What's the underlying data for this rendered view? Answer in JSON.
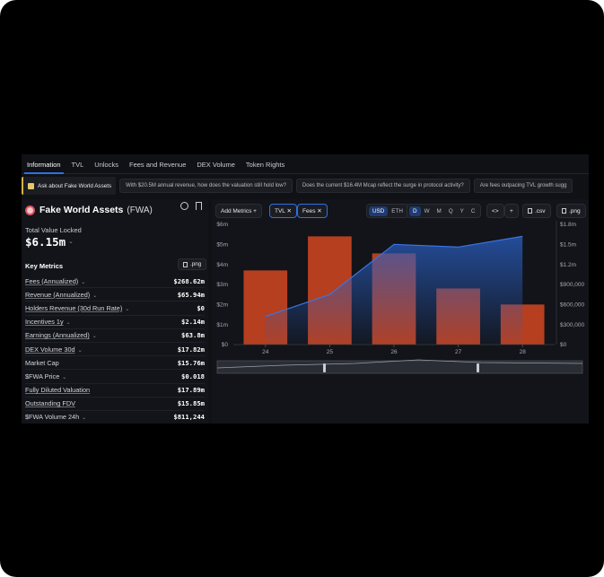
{
  "tabs": [
    "Information",
    "TVL",
    "Unlocks",
    "Fees and Revenue",
    "DEX Volume",
    "Token Rights"
  ],
  "ask": {
    "label": "Ask about Fake World Assets",
    "suggestions": [
      "With $20.5M annual revenue, how does the valuation still hold low?",
      "Does the current $16.4M Mcap reflect the surge in protocol activity?",
      "Are fees outpacing TVL growth sugg"
    ]
  },
  "protocol": {
    "name": "Fake World Assets",
    "symbol": "(FWA)",
    "tvl_label": "Total Value Locked",
    "tvl_value": "$6.15m"
  },
  "key_metrics": {
    "title": "Key Metrics",
    "png_label": ".png",
    "rows": [
      {
        "label": "Fees (Annualized)",
        "value": "$268.62m",
        "underline": true,
        "caret": true
      },
      {
        "label": "Revenue (Annualized)",
        "value": "$65.94m",
        "underline": true,
        "caret": true
      },
      {
        "label": "Holders Revenue (30d Run Rate)",
        "value": "$0",
        "underline": true,
        "caret": true
      },
      {
        "label": "Incentives 1y",
        "value": "$2.14m",
        "underline": true,
        "caret": true
      },
      {
        "label": "Earnings (Annualized)",
        "value": "$63.8m",
        "underline": true,
        "caret": true
      },
      {
        "label": "DEX Volume 30d",
        "value": "$17.82m",
        "underline": true,
        "caret": true
      },
      {
        "label": "Market Cap",
        "value": "$15.76m",
        "underline": false,
        "caret": false
      },
      {
        "label": "$FWA Price",
        "value": "$0.018",
        "underline": false,
        "caret": true
      },
      {
        "label": "Fully Diluted Valuation",
        "value": "$17.89m",
        "underline": true,
        "caret": false
      },
      {
        "label": "Outstanding FDV",
        "value": "$15.85m",
        "underline": true,
        "caret": false
      },
      {
        "label": "$FWA Volume 24h",
        "value": "$811,244",
        "underline": false,
        "caret": true
      }
    ]
  },
  "toolbar": {
    "add_metrics": "Add Metrics +",
    "tvl_chip": "TVL ✕",
    "fees_chip": "Fees ✕",
    "currency": [
      "USD",
      "ETH"
    ],
    "currency_selected": "USD",
    "periods": [
      "D",
      "W",
      "M",
      "Q",
      "Y",
      "C"
    ],
    "period_selected": "D",
    "embed_icon": "code-icon",
    "add_icon": "plus-icon",
    "csv_label": ".csv",
    "png_label": ".png"
  },
  "colors": {
    "bar": "#c4431f",
    "tvl_line": "#3b74e0",
    "accent": "#2f6fe4",
    "background": "#121419"
  },
  "chart_data": {
    "type": "bar+area",
    "categories": [
      "24",
      "25",
      "26",
      "27",
      "28"
    ],
    "series": [
      {
        "name": "Fees",
        "kind": "bar",
        "axis": "left",
        "values": [
          3.7,
          5.4,
          4.55,
          2.8,
          2.0
        ]
      },
      {
        "name": "TVL",
        "kind": "area",
        "axis": "right",
        "values": [
          0.42,
          0.75,
          1.5,
          1.46,
          1.62
        ]
      }
    ],
    "left_axis": {
      "ticks": [
        "$0",
        "$1m",
        "$2m",
        "$3m",
        "$4m",
        "$5m",
        "$6m"
      ],
      "ylim": [
        0,
        6
      ]
    },
    "right_axis": {
      "ticks": [
        "$0",
        "$300,000",
        "$600,000",
        "$900,000",
        "$1.2m",
        "$1.5m",
        "$1.8m"
      ],
      "ylim": [
        0,
        1.8
      ]
    },
    "grid": false
  }
}
